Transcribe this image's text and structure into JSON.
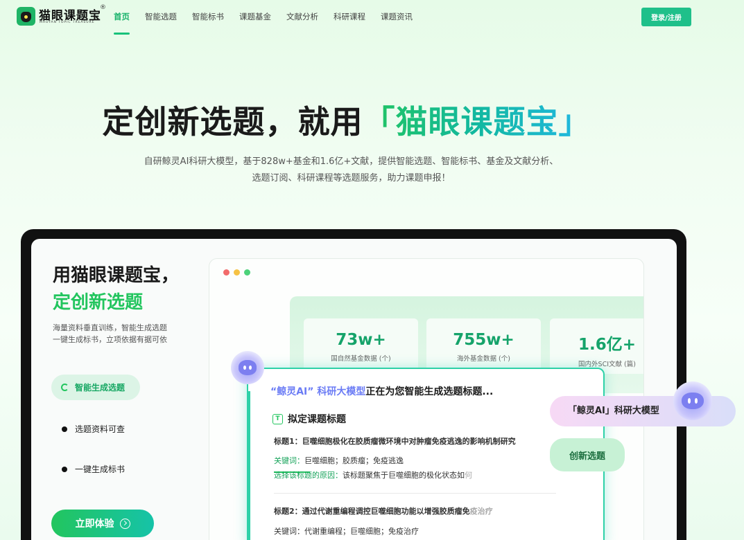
{
  "nav": {
    "logo_name": "猫眼课题宝",
    "logo_reg": "®",
    "logo_sub": "MAOYAN TOPIC TREASURE",
    "items": [
      "首页",
      "智能选题",
      "智能标书",
      "课题基金",
      "文献分析",
      "科研课程",
      "课题资讯"
    ],
    "login": "登录/注册"
  },
  "hero": {
    "title_prefix": "定创新选题，就用",
    "title_brand": "「猫眼课题宝」",
    "desc_line1": "自研鲸灵AI科研大模型，基于828w+基金和1.6亿+文献，提供智能选题、智能标书、基金及文献分析、",
    "desc_line2": "选题订阅、科研课程等选题服务，助力课题申报！"
  },
  "panel": {
    "title1": "用猫眼课题宝，",
    "title2": "定创新选题",
    "desc_line1": "海量资料垂直训练，智能生成选题",
    "desc_line2": "一键生成标书，立项依据有据可依",
    "features": [
      "智能生成选题",
      "选题资料可查",
      "一键生成标书"
    ],
    "cta": "立即体验"
  },
  "stats": [
    {
      "num": "73w+",
      "label": "国自然基金数据 (个)"
    },
    {
      "num": "755w+",
      "label": "海外基金数据 (个)"
    },
    {
      "num": "1.6亿+",
      "label": "国内外SCI文献 (篇)"
    }
  ],
  "gen": {
    "head_hl": "“鲸灵AI” 科研大模型",
    "head_rest": "正在为您智能生成选题标题...",
    "sub": "拟定课题标题",
    "sub_icon": "T",
    "t1": "标题1：巨噬细胞极化在胶质瘤微环境中对肿瘤免疫逃逸的影响机制研究",
    "k1_label": "关键词：",
    "k1_value": "巨噬细胞；胶质瘤；免疫逃逸",
    "r1_label": "选择该标题的原因：",
    "r1_value": "该标题聚焦于巨噬细胞的极化状态如",
    "r1_fade": "何",
    "t2": "标题2：通过代谢重编程调控巨噬细胞功能以增强胶质瘤免",
    "t2_fade": "疫治疗",
    "k2_label": "关键词：",
    "k2_value": "代谢重编程；巨噬细胞；免疫治疗"
  },
  "float": {
    "ai_label": "「鲸灵AI」科研大模型",
    "chip": "创新选题"
  },
  "colors": {
    "accent": "#22c55e",
    "accent_teal": "#2ed1a8",
    "dot_red": "#f26b6b",
    "dot_yellow": "#f6c244",
    "dot_green": "#4cd27a"
  }
}
